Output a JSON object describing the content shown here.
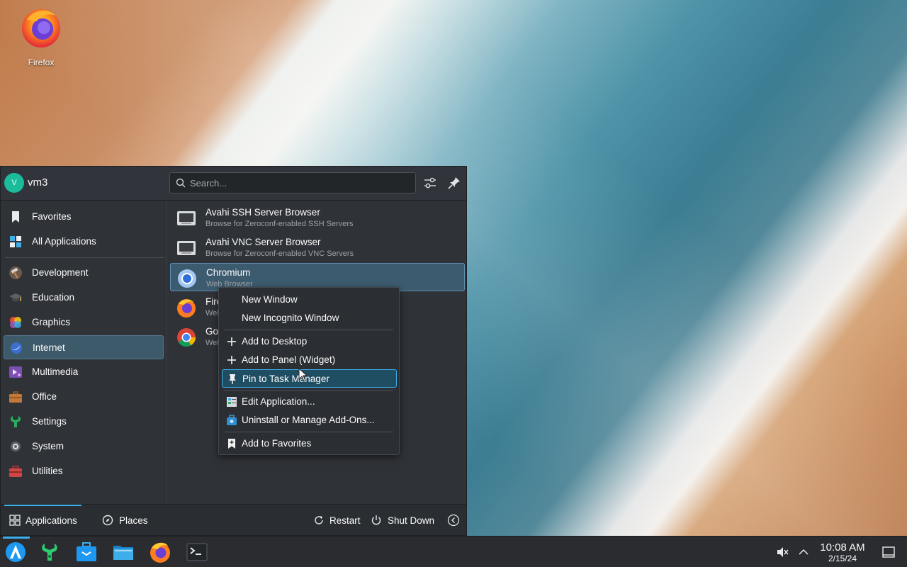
{
  "desktop": {
    "icons": [
      {
        "label": "Firefox",
        "icon": "firefox-icon"
      }
    ]
  },
  "launcher": {
    "user": {
      "initial": "V",
      "name": "vm3"
    },
    "search": {
      "placeholder": "Search..."
    },
    "header_buttons": [
      "configure-icon",
      "pin-icon"
    ],
    "sidebar": {
      "items": [
        {
          "label": "Favorites",
          "icon": "bookmark-icon"
        },
        {
          "label": "All Applications",
          "icon": "all-apps-icon"
        },
        {
          "label": "Development",
          "icon": "hammer-icon"
        },
        {
          "label": "Education",
          "icon": "graduation-cap-icon"
        },
        {
          "label": "Graphics",
          "icon": "palette-icon"
        },
        {
          "label": "Internet",
          "icon": "globe-icon",
          "active": true
        },
        {
          "label": "Multimedia",
          "icon": "multimedia-icon"
        },
        {
          "label": "Office",
          "icon": "briefcase-icon"
        },
        {
          "label": "Settings",
          "icon": "settings-wrench-icon"
        },
        {
          "label": "System",
          "icon": "system-gear-icon"
        },
        {
          "label": "Utilities",
          "icon": "toolbox-icon"
        }
      ]
    },
    "apps": [
      {
        "name": "Avahi SSH Server Browser",
        "desc": "Browse for Zeroconf-enabled SSH Servers",
        "icon": "network-server-icon"
      },
      {
        "name": "Avahi VNC Server Browser",
        "desc": "Browse for Zeroconf-enabled VNC Servers",
        "icon": "network-server-icon"
      },
      {
        "name": "Chromium",
        "desc": "Web Browser",
        "icon": "chromium-icon",
        "highlighted": true
      },
      {
        "name": "Fire",
        "desc": "Web",
        "icon": "firefox-icon"
      },
      {
        "name": "Goo",
        "desc": "Web",
        "icon": "chrome-icon"
      }
    ],
    "footer": {
      "tabs": [
        {
          "label": "Applications",
          "icon": "grid-icon",
          "active": true
        },
        {
          "label": "Places",
          "icon": "compass-icon"
        }
      ],
      "actions": [
        {
          "label": "Restart",
          "icon": "restart-icon"
        },
        {
          "label": "Shut Down",
          "icon": "power-icon"
        }
      ],
      "more_icon": "chevron-left-icon"
    }
  },
  "context_menu": {
    "items": [
      {
        "label": "New Window",
        "icon": ""
      },
      {
        "label": "New Incognito Window",
        "icon": ""
      },
      {
        "label": "Add to Desktop",
        "icon": "plus-icon"
      },
      {
        "label": "Add to Panel (Widget)",
        "icon": "plus-icon"
      },
      {
        "label": "Pin to Task Manager",
        "icon": "pin-icon",
        "highlighted": true
      },
      {
        "label": "Edit Application...",
        "icon": "edit-app-icon"
      },
      {
        "label": "Uninstall or Manage Add-Ons...",
        "icon": "discover-icon"
      },
      {
        "label": "Add to Favorites",
        "icon": "bookmark-add-icon"
      }
    ]
  },
  "taskbar": {
    "launchers": [
      "kde-launcher-icon",
      "system-settings-icon",
      "discover-icon",
      "file-manager-icon",
      "firefox-icon",
      "terminal-icon"
    ],
    "tray": {
      "icons": [
        "volume-muted-icon",
        "chevron-up-icon"
      ],
      "time": "10:08 AM",
      "date": "2/15/24",
      "show_desktop_icon": "show-desktop-icon"
    }
  },
  "colors": {
    "accent": "#3daee9",
    "panel_bg": "#2f3237",
    "highlight_bg": "#3c5b6e"
  }
}
